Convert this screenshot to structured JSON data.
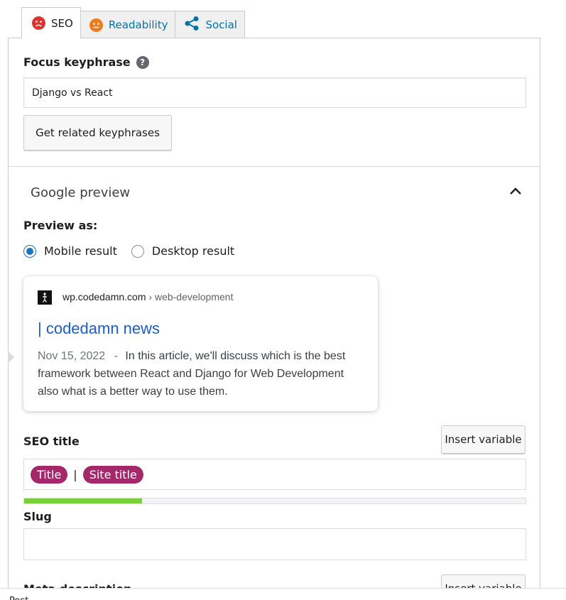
{
  "tabs": [
    {
      "label": "SEO",
      "icon": "frown-face-icon",
      "color": "#dc3232"
    },
    {
      "label": "Readability",
      "icon": "neutral-face-icon",
      "color": "#ee7c1b"
    },
    {
      "label": "Social",
      "icon": "share-icon",
      "color": "#0073aa"
    }
  ],
  "focus": {
    "label": "Focus keyphrase",
    "value": "Django vs React",
    "related_button": "Get related keyphrases"
  },
  "google_preview": {
    "title": "Google preview",
    "preview_as_label": "Preview as:",
    "options": [
      "Mobile result",
      "Desktop result"
    ],
    "selected": "Mobile result"
  },
  "snippet": {
    "domain": "wp.codedamn.com",
    "breadcrumb": "› web-development",
    "title": "| codedamn news",
    "date": "Nov 15, 2022",
    "separator": "-",
    "description": "In this article, we'll discuss which is the best framework between React and Django for Web Development also what is a better way to use them."
  },
  "seo_title": {
    "label": "SEO title",
    "insert_button": "Insert variable",
    "pills": [
      "Title",
      "Site title"
    ],
    "separator": "|",
    "progress": 0.235
  },
  "slug": {
    "label": "Slug",
    "value": ""
  },
  "meta": {
    "label": "Meta description",
    "insert_button": "Insert variable"
  },
  "footer": {
    "label": "Post"
  },
  "colors": {
    "accent": "#0073aa",
    "pill": "#a4286a",
    "progress_good": "#7ad03a",
    "link": "#1a5dc8"
  }
}
